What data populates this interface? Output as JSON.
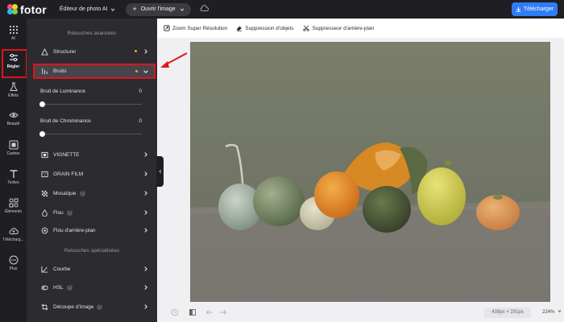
{
  "header": {
    "logo_text": "fotor",
    "editor_menu": "Éditeur de photo AI",
    "open_image": "Ouvrir l'image",
    "download": "Télécharger"
  },
  "rail": [
    {
      "label": "AI",
      "icon": "grid-icon"
    },
    {
      "label": "Régler",
      "icon": "sliders-icon",
      "active": true
    },
    {
      "label": "Effets",
      "icon": "flask-icon"
    },
    {
      "label": "Beauté",
      "icon": "eye-icon"
    },
    {
      "label": "Cadres",
      "icon": "frame-icon"
    },
    {
      "label": "Textes",
      "icon": "text-icon"
    },
    {
      "label": "Éléments",
      "icon": "shapes-icon"
    },
    {
      "label": "Télécharg...",
      "icon": "cloud-upload-icon"
    },
    {
      "label": "Plus",
      "icon": "more-icon"
    }
  ],
  "panel": {
    "advanced_title": "Retouches avancées",
    "structure": "Structurer",
    "noise": "Bruits",
    "luminance_label": "Bruit de Luminance",
    "luminance_value": "0",
    "chrominance_label": "Bruit de Chrominance",
    "chrominance_value": "0",
    "vignette": "VIGNETTE",
    "grain": "GRAIN FILM",
    "mosaic": "Mosaïque",
    "blur": "Flou",
    "bg_blur": "Flou d'arrière-plan",
    "special_title": "Retouches spécialisées",
    "curve": "Courbe",
    "hsl": "HSL",
    "crop": "Découpe d'image"
  },
  "toolbar": {
    "zoom_super": "Zoom Super Résolution",
    "remove_objects": "Suppression d'objets",
    "bg_remover": "Suppresseur d'arrière-plan"
  },
  "bottom": {
    "dimensions": "439px × 291px",
    "zoom": "224%"
  },
  "colors": {
    "accent": "#2f7cf6",
    "highlight": "#e0141b",
    "modified_dot": "#f1a33a"
  }
}
